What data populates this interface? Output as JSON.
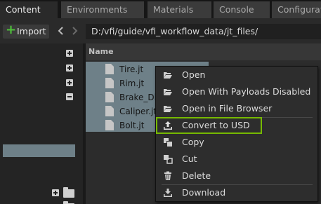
{
  "tabs": [
    {
      "label": "Content",
      "active": true
    },
    {
      "label": "Environments",
      "active": false
    },
    {
      "label": "Materials",
      "active": false
    },
    {
      "label": "Console",
      "active": false
    },
    {
      "label": "Configurat",
      "active": false
    }
  ],
  "toolbar": {
    "import_label": "Import",
    "path": "D:/vfi/guide/vfi_workflow_data/jt_files/"
  },
  "content": {
    "column_header": "Name",
    "files": [
      {
        "name": "Tire.jt"
      },
      {
        "name": "Rim.jt"
      },
      {
        "name": "Brake_Di"
      },
      {
        "name": "Caliper.jt"
      },
      {
        "name": "Bolt.jt"
      }
    ]
  },
  "context_menu": {
    "highlight_color": "#76b900",
    "items": [
      {
        "label": "Open",
        "icon": "folder-open-icon"
      },
      {
        "label": "Open With Payloads Disabled",
        "icon": "folder-open-icon"
      },
      {
        "label": "Open in File Browser",
        "icon": "folder-open-icon"
      },
      {
        "label": "Convert to USD",
        "icon": "upload-icon",
        "highlighted": true
      },
      {
        "label": "Copy",
        "icon": "copy-icon"
      },
      {
        "label": "Cut",
        "icon": "cut-icon"
      },
      {
        "label": "Delete",
        "icon": "trash-icon"
      },
      {
        "label": "Download",
        "icon": "download-icon"
      }
    ]
  }
}
